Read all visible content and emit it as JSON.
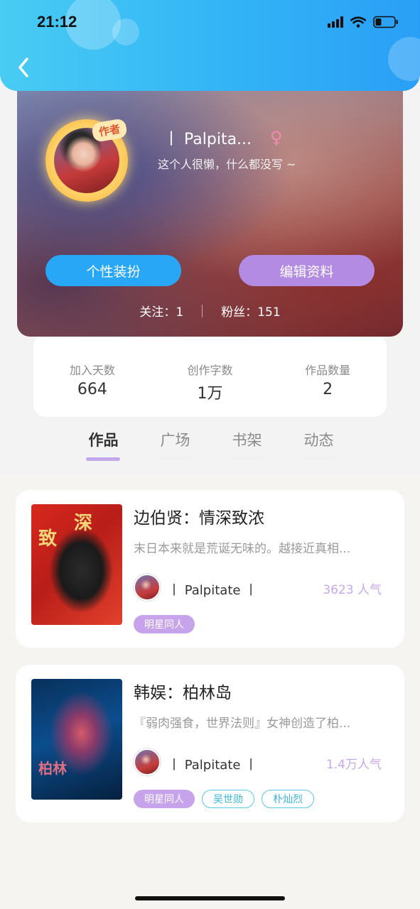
{
  "status_bar": {
    "time": "21:12"
  },
  "profile": {
    "avatar_badge": "作者",
    "nickname": "丨 Palpita...",
    "gender_symbol": "♀",
    "bio": "这个人很懒，什么都没写 ~",
    "buttons": {
      "dress_up": "个性装扮",
      "edit_profile": "编辑资料"
    },
    "following": "关注：1",
    "fans": "粉丝：151"
  },
  "stats": [
    {
      "label": "加入天数",
      "value": "664"
    },
    {
      "label": "创作字数",
      "value": "1万"
    },
    {
      "label": "作品数量",
      "value": "2"
    }
  ],
  "tabs": [
    "作品",
    "广场",
    "书架",
    "动态"
  ],
  "active_tab": "作品",
  "works": [
    {
      "title": "边伯贤：情深致浓",
      "description": "末日本来就是荒诞无味的。越接近真相...",
      "author": "丨 Palpitate 丨",
      "popularity": "3623 人气",
      "tags": [
        "明星同人"
      ]
    },
    {
      "title": "韩娱：柏林岛",
      "description": "『弱肉强食，世界法则』女神创造了柏...",
      "author": "丨 Palpitate 丨",
      "popularity": "1.4万人气",
      "tags": [
        "明星同人",
        "吴世勋",
        "朴灿烈"
      ]
    }
  ],
  "colors": {
    "header": "#34b6f6",
    "dress_button": "#27a7f5",
    "edit_button": "#b48be2",
    "accent_purple": "#c8a7f1"
  }
}
